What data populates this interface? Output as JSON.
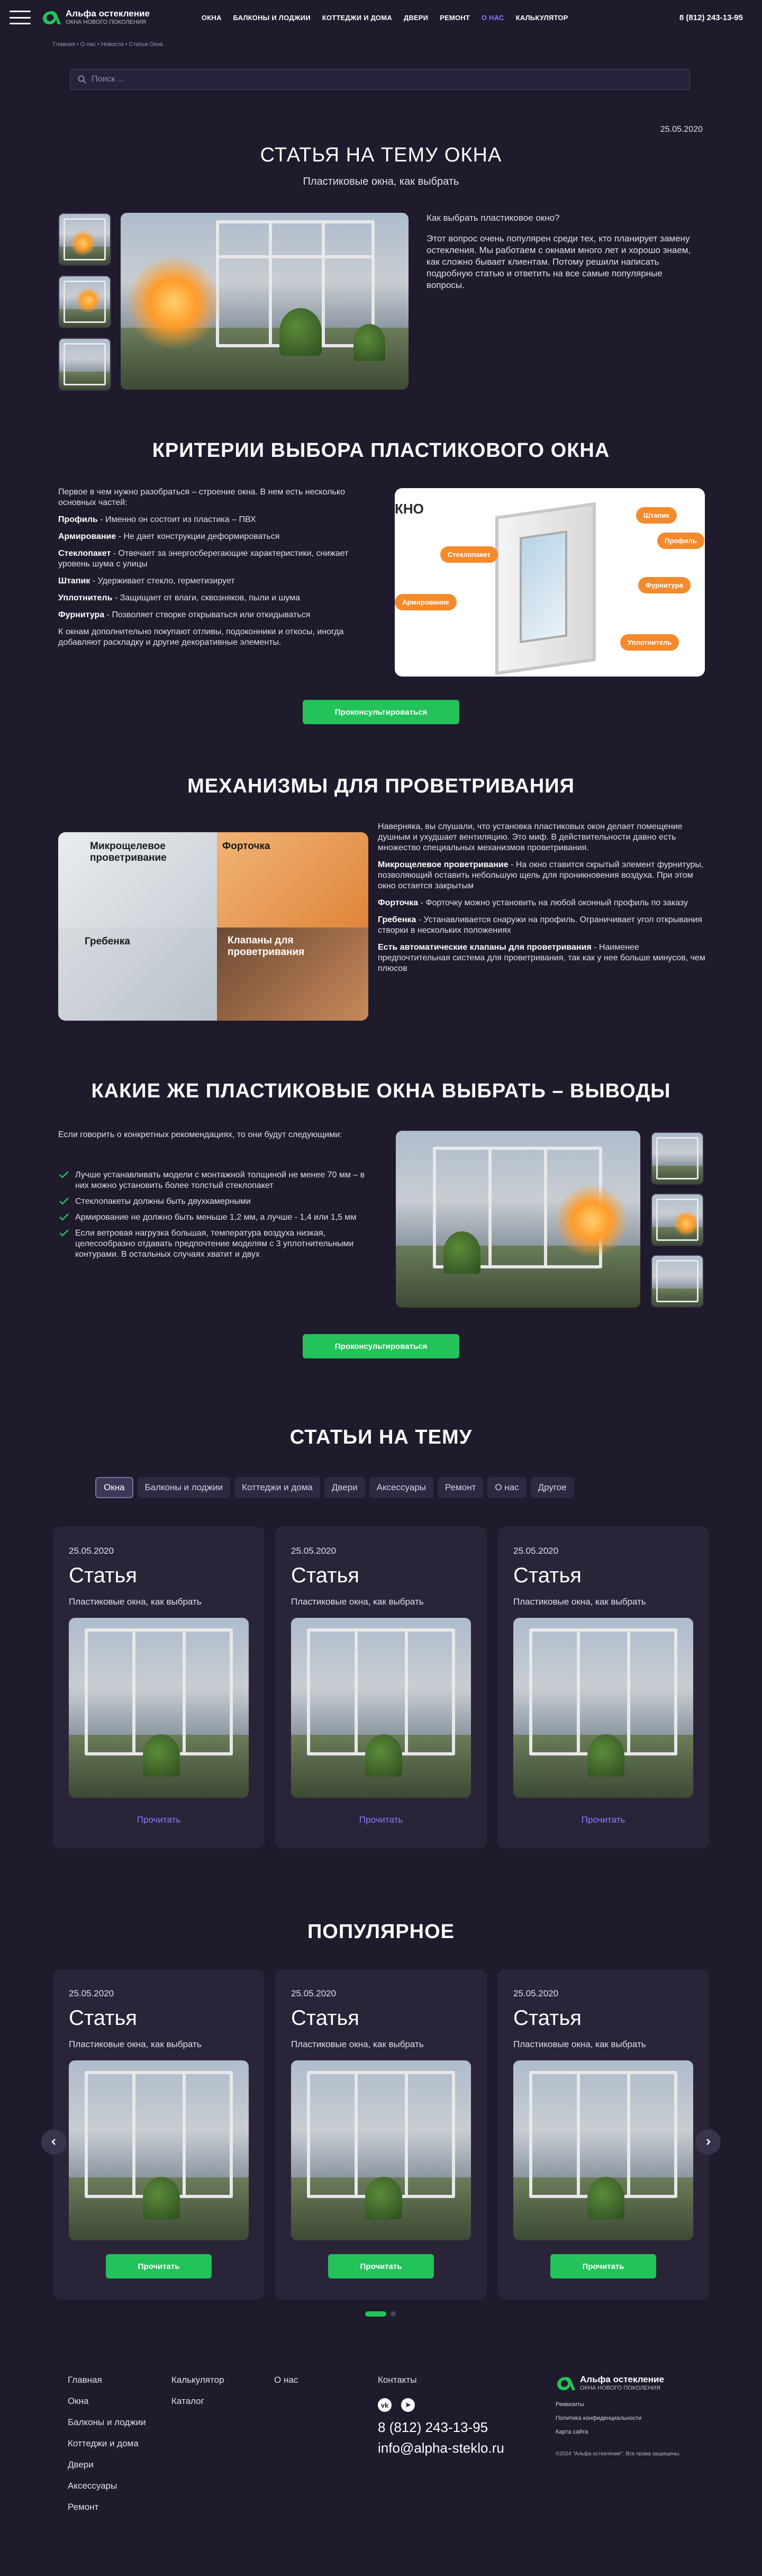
{
  "header": {
    "logo_title": "Альфа остекление",
    "logo_sub": "ОКНА НОВОГО ПОКОЛЕНИЯ",
    "nav": [
      "ОКНА",
      "БАЛКОНЫ И ЛОДЖИИ",
      "КОТТЕДЖИ И ДОМА",
      "ДВЕРИ",
      "РЕМОНТ",
      "О НАС",
      "КАЛЬКУЛЯТОР"
    ],
    "active_nav_index": 5,
    "phone": "8 (812) 243-13-95"
  },
  "breadcrumbs": "Главная  •  О нас  •  Новости  •  Статьи Окна",
  "search": {
    "placeholder": "Поиск ..."
  },
  "article": {
    "date": "25.05.2020",
    "title": "СТАТЬЯ НА ТЕМУ ОКНА",
    "subtitle": "Пластиковые окна, как выбрать",
    "intro_q": "Как выбрать пластиковое окно?",
    "intro_p": "Этот вопрос очень популярен среди тех, кто планирует замену остекления. Мы работаем с окнами много лет и хорошо знаем, как сложно бывает клиентам. Потому решили написать подробную статью и ответить на все самые популярные вопросы."
  },
  "criteria": {
    "title": "КРИТЕРИИ ВЫБОРА ПЛАСТИКОВОГО ОКНА",
    "lead": "Первое в чем нужно разобраться – строение окна. В нем есть несколько основных частей:",
    "items": [
      {
        "term": "Профиль",
        "text": " - Именно он состоит из пластика – ПВХ"
      },
      {
        "term": "Армирование",
        "text": " - Не дает конструкции деформироваться"
      },
      {
        "term": "Стеклопакет",
        "text": " - Отвечает за энергосберегающие характеристики, снижает уровень шума с улицы"
      },
      {
        "term": "Штапик",
        "text": " - Удерживает стекло, герметизирует"
      },
      {
        "term": "Уплотнитель",
        "text": " - Защищает от влаги, сквозняков, пыли и шума"
      },
      {
        "term": "Фурнитура",
        "text": " - Позволяет створке открываться или откидываться"
      }
    ],
    "tail": "К окнам дополнительно покупают отливы, подоконники и откосы, иногда добавляют раскладку и другие декоративные элементы.",
    "schema_brand": "КНО",
    "schema_tags": [
      "Штапик",
      "Профиль",
      "Стеклопакет",
      "Фурнитура",
      "Армирование",
      "Уплотнитель"
    ],
    "button": "Проконсультироваться"
  },
  "mechanisms": {
    "title": "МЕХАНИЗМЫ ДЛЯ ПРОВЕТРИВАНИЯ",
    "lead": "Наверняка, вы слушали, что установка пластиковых окон делает помещение душным и ухудшает вентиляцию. Это миф. В действительности давно есть множество специальных механизмов проветривания.",
    "items": [
      {
        "term": "Микрощелевое проветривание",
        "text": " - На окно ставится скрытый элемент фурнитуры, позволяющий оставить небольшую щель для проникновения воздуха. При этом окно остается закрытым"
      },
      {
        "term": "Форточка",
        "text": " - Форточку можно установить на любой оконный профиль по заказу"
      },
      {
        "term": "Гребенка",
        "text": " - Устанавливается снаружи на профиль. Ограничивает угол открывания створки в нескольких положениях"
      },
      {
        "term": "Есть автоматические клапаны для проветривания",
        "text": " - Наименее предпочтительная система для проветривания, так как у нее больше минусов, чем плюсов"
      }
    ],
    "collage": [
      "Микрощелевое проветривание",
      "Форточка",
      "Гребенка",
      "Клапаны для проветривания"
    ]
  },
  "conclusion": {
    "title": "КАКИЕ ЖЕ ПЛАСТИКОВЫЕ ОКНА ВЫБРАТЬ – ВЫВОДЫ",
    "lead": "Если говорить о конкретных рекомендациях, то они будут следующими:",
    "items": [
      "Лучше устанавливать модели с монтажной толщиной не менее 70 мм – в них можно установить более толстый стеклопакет",
      "Стеклопакеты должны быть двухкамерными",
      "Армирование не должно быть меньше 1,2 мм, а лучше - 1,4 или 1,5 мм",
      "Если ветровая нагрузка большая, температура воздуха низкая, целесообразно отдавать предпочтение моделям с 3 уплотнительными контурами. В остальных случаях хватит и двух"
    ],
    "button": "Проконсультироваться"
  },
  "related": {
    "title": "СТАТЬИ НА ТЕМУ",
    "tabs": [
      "Окна",
      "Балконы и лоджии",
      "Коттеджи и дома",
      "Двери",
      "Аксессуары",
      "Ремонт",
      "О нас",
      "Другое"
    ],
    "active_tab": 0,
    "cards": [
      {
        "date": "25.05.2020",
        "title": "Статья",
        "sub": "Пластиковые окна, как выбрать",
        "action": "Прочитать"
      },
      {
        "date": "25.05.2020",
        "title": "Статья",
        "sub": "Пластиковые окна, как выбрать",
        "action": "Прочитать"
      },
      {
        "date": "25.05.2020",
        "title": "Статья",
        "sub": "Пластиковые окна, как выбрать",
        "action": "Прочитать"
      }
    ]
  },
  "popular": {
    "title": "ПОПУЛЯРНОЕ",
    "cards": [
      {
        "date": "25.05.2020",
        "title": "Статья",
        "sub": "Пластиковые окна, как выбрать",
        "action": "Прочитать"
      },
      {
        "date": "25.05.2020",
        "title": "Статья",
        "sub": "Пластиковые окна, как выбрать",
        "action": "Прочитать"
      },
      {
        "date": "25.05.2020",
        "title": "Статья",
        "sub": "Пластиковые окна, как выбрать",
        "action": "Прочитать"
      }
    ],
    "active_slide": 0,
    "slide_count": 2
  },
  "footer": {
    "col1": [
      "Главная",
      "Окна",
      "Балконы и лоджии",
      "Коттеджи и дома",
      "Двери",
      "Аксессуары",
      "Ремонт"
    ],
    "col2": [
      "Калькулятор",
      "Каталог"
    ],
    "col3": [
      "О нас"
    ],
    "contacts_label": "Контакты",
    "phone": "8 (812) 243-13-95",
    "email": "info@alpha-steklo.ru",
    "social": [
      "vk-icon",
      "telegram-icon"
    ],
    "logo_title": "Альфа остекление",
    "logo_sub": "ОКНА НОВОГО ПОКОЛЕНИЯ",
    "links": [
      "Реквизиты",
      "Политика конфиденциальности",
      "Карта сайта"
    ],
    "copyright": "©2024 \"Альфа остекление\". Все права защищены."
  },
  "colors": {
    "bg": "#1f1a2c",
    "card": "#2a2439",
    "accent": "#23c25a",
    "link": "#8a7bff",
    "tag": "#f48a2c"
  }
}
